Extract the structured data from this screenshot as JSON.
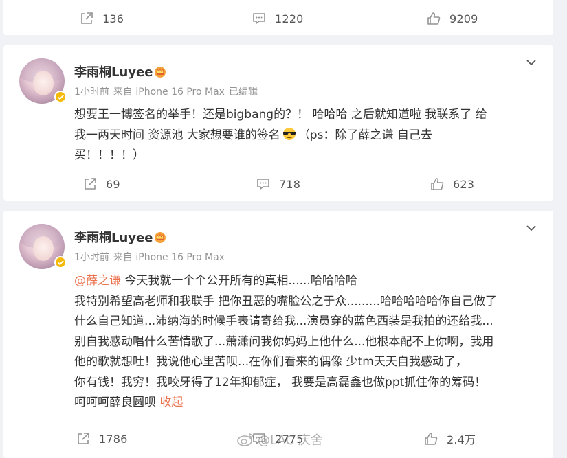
{
  "top_post": {
    "actions": {
      "share_count": "136",
      "comment_count": "1220",
      "like_count": "9209"
    }
  },
  "posts": [
    {
      "author": "李雨桐Luyee",
      "time": "1小时前",
      "source": "来自 iPhone 16 Pro Max",
      "edited": "已编辑",
      "text_lines": [
        "想要王一博签名的举手！还是bigbang的？！  哈哈哈 之后就知道啦 我联系了 给",
        "我一两天时间 资源池 大家想要谁的签名",
        "（ps：除了薛之谦 自己去",
        "买！！！！）"
      ],
      "actions": {
        "share_count": "69",
        "comment_count": "718",
        "like_count": "623"
      }
    },
    {
      "author": "李雨桐Luyee",
      "time": "1小时前",
      "source": "来自 iPhone 16 Pro Max",
      "mention": "@薛之谦",
      "text_first": " 今天我就一个个公开所有的真相......哈哈哈哈",
      "text_lines": [
        "我特别希望高老师和我联手 把你丑恶的嘴脸公之于众.........哈哈哈哈哈你自己做了",
        "什么自己知道...沛纳海的时候手表请寄给我...演员穿的蓝色西装是我拍的还给我...",
        "别自我感动唱什么苦情歌了...萧潇问我你妈妈上他什么...他根本配不上你啊，我用",
        "他的歌就想吐！我说他心里苦呗...在你们看来的偶像 少tm天天自我感动了，",
        "你有钱！我穷！我咬牙得了12年抑郁症， 我要是高磊鑫也做ppt抓住你的筹码！"
      ],
      "text_last": "呵呵呵薛良圆呗 ",
      "collapse_label": "收起",
      "actions": {
        "share_count": "1786",
        "comment_count": "2775",
        "like_count": "2.4万"
      }
    }
  ],
  "watermark": "@LAC 庆舍",
  "colors": {
    "link": "#eb7350",
    "meta": "#939393",
    "icon": "#939393",
    "badge": "#f5b90a"
  },
  "icons": [
    "share-icon",
    "comment-icon",
    "like-icon",
    "chevron-down-icon",
    "verified-badge-icon",
    "crown-icon",
    "cool-emoji-icon",
    "weibo-watermark-icon"
  ]
}
